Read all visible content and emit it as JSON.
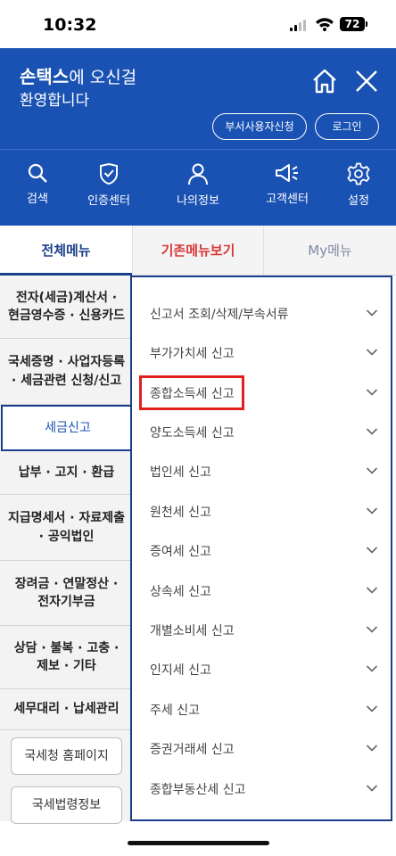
{
  "status": {
    "time": "10:32",
    "battery": "72"
  },
  "header": {
    "brand": "손택스",
    "greeting_rest": "에 오신걸",
    "greeting_line2": "환영합니다",
    "dept_button": "부서사용자신청",
    "login_button": "로그인"
  },
  "icon_menu": [
    {
      "label": "검색",
      "icon": "search-icon"
    },
    {
      "label": "인증센터",
      "icon": "shield-check-icon"
    },
    {
      "label": "나의정보",
      "icon": "person-icon"
    },
    {
      "label": "고객센터",
      "icon": "megaphone-icon"
    },
    {
      "label": "설정",
      "icon": "gear-icon"
    }
  ],
  "tabs": {
    "all": "전체메뉴",
    "old": "기존메뉴보기",
    "my": "My메뉴"
  },
  "categories": [
    {
      "line1": "전자(세금)계산서 ·",
      "line2": "현금영수증 · 신용카드"
    },
    {
      "line1": "국세증명 · 사업자등록",
      "line2": "· 세금관련 신청/신고"
    },
    {
      "line1": "세금신고",
      "line2": ""
    },
    {
      "line1": "납부 · 고지 · 환급",
      "line2": ""
    },
    {
      "line1": "지급명세서 · 자료제출",
      "line2": "· 공익법인"
    },
    {
      "line1": "장려금 · 연말정산 ·",
      "line2": "전자기부금"
    },
    {
      "line1": "상담 · 불복 · 고충 ·",
      "line2": "제보 · 기타"
    },
    {
      "line1": "세무대리 · 납세관리",
      "line2": ""
    }
  ],
  "link_buttons": [
    "국세청 홈페이지",
    "국세법령정보"
  ],
  "submenu": [
    "신고서 조회/삭제/부속서류",
    "부가가치세 신고",
    "종합소득세 신고",
    "양도소득세 신고",
    "법인세 신고",
    "원천세 신고",
    "증여세 신고",
    "상속세 신고",
    "개별소비세 신고",
    "인지세 신고",
    "주세 신고",
    "증권거래세 신고",
    "종합부동산세 신고"
  ],
  "colors": {
    "header_blue": "#1a52b3",
    "nav_dark": "#1a3f8a",
    "highlight_red": "#e02020",
    "tab_red": "#d93737"
  }
}
